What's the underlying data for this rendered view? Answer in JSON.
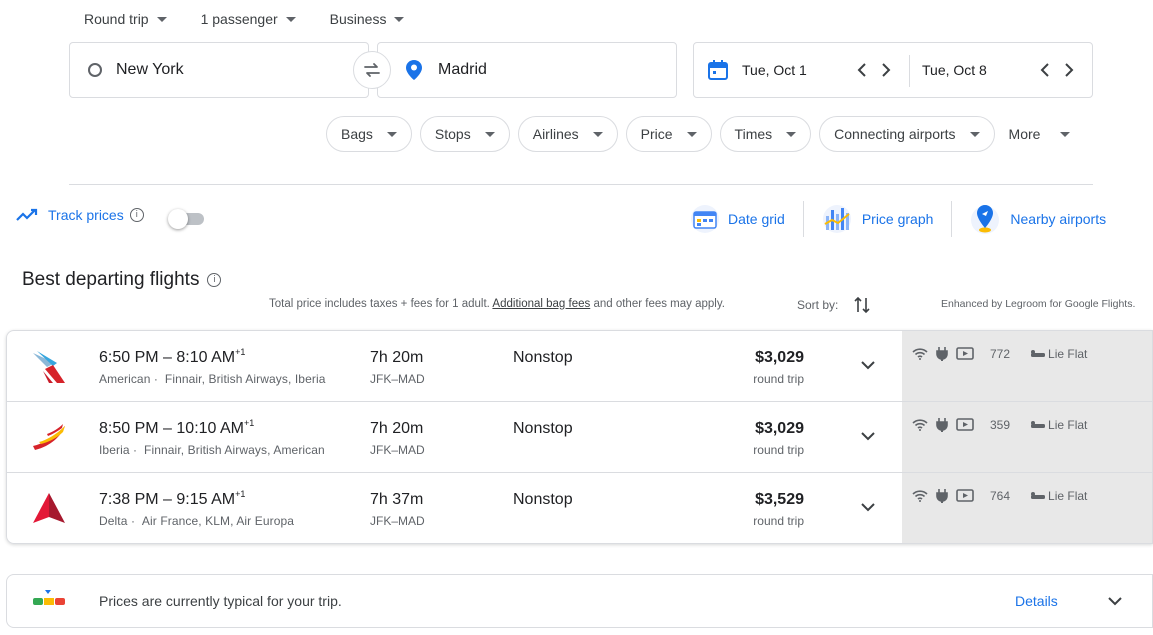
{
  "search": {
    "trip_type": "Round trip",
    "passengers": "1 passenger",
    "cabin": "Business",
    "origin": "New York",
    "destination": "Madrid",
    "depart_date": "Tue, Oct 1",
    "return_date": "Tue, Oct 8"
  },
  "filters": [
    "Bags",
    "Stops",
    "Airlines",
    "Price",
    "Times",
    "Connecting airports",
    "More"
  ],
  "track_prices": {
    "label": "Track prices",
    "enabled": false
  },
  "tools": {
    "date_grid": "Date grid",
    "price_graph": "Price graph",
    "nearby_airports": "Nearby airports"
  },
  "results_header": {
    "title": "Best departing flights",
    "total_note": "Total price includes taxes + fees for 1 adult.",
    "bag_fees_link": "Additional bag fees",
    "other_fees": "and other fees may apply.",
    "sort_by": "Sort by:",
    "enhanced": "Enhanced by Legroom for Google Flights."
  },
  "flights": [
    {
      "depart": "6:50 PM",
      "arrive": "8:10 AM",
      "day_offset": "+1",
      "airline": "American",
      "partners": "Finnair, British Airways, Iberia",
      "duration": "7h 20m",
      "route": "JFK–MAD",
      "stops": "Nonstop",
      "price": "$3,029",
      "price_label": "round trip",
      "legroom": "772",
      "seat": "Lie Flat",
      "logo": "american-logo-icon"
    },
    {
      "depart": "8:50 PM",
      "arrive": "10:10 AM",
      "day_offset": "+1",
      "airline": "Iberia",
      "partners": "Finnair, British Airways, American",
      "duration": "7h 20m",
      "route": "JFK–MAD",
      "stops": "Nonstop",
      "price": "$3,029",
      "price_label": "round trip",
      "legroom": "359",
      "seat": "Lie Flat",
      "logo": "iberia-logo-icon"
    },
    {
      "depart": "7:38 PM",
      "arrive": "9:15 AM",
      "day_offset": "+1",
      "airline": "Delta",
      "partners": "Air France, KLM, Air Europa",
      "duration": "7h 37m",
      "route": "JFK–MAD",
      "stops": "Nonstop",
      "price": "$3,529",
      "price_label": "round trip",
      "legroom": "764",
      "seat": "Lie Flat",
      "logo": "delta-logo-icon"
    }
  ],
  "price_insight": {
    "text": "Prices are currently typical for your trip.",
    "details": "Details"
  },
  "colors": {
    "accent": "#1a73e8",
    "text": "#202124",
    "muted": "#5f6368",
    "border": "#dadce0",
    "amenity_bg": "#e8e8e8"
  }
}
